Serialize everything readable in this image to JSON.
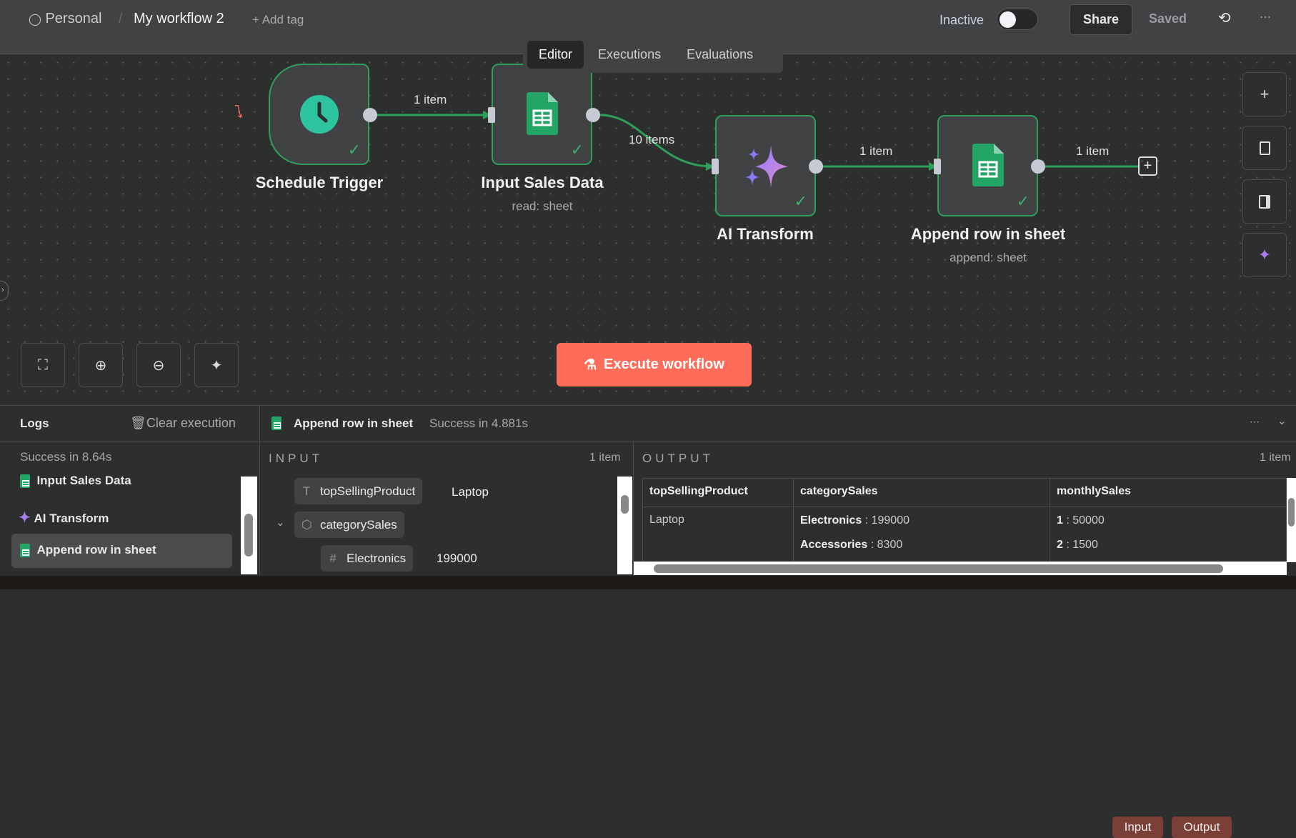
{
  "header": {
    "project": "Personal",
    "workflow_name": "My workflow 2",
    "add_tag": "+ Add tag",
    "status": "Inactive",
    "active": false,
    "share": "Share",
    "saved": "Saved"
  },
  "tabs": [
    {
      "label": "Editor",
      "active": true
    },
    {
      "label": "Executions"
    },
    {
      "label": "Evaluations"
    }
  ],
  "nodes": [
    {
      "name": "Schedule Trigger"
    },
    {
      "name": "Input Sales Data",
      "subtitle": "read: sheet"
    },
    {
      "name": "AI Transform"
    },
    {
      "name": "Append row in sheet",
      "subtitle": "append: sheet"
    }
  ],
  "edges": [
    "1 item",
    "10 items",
    "1 item",
    "1 item"
  ],
  "execute_button": "Execute workflow",
  "colors": {
    "accent": "#ff6d5a",
    "success": "#2f9e5a",
    "topbar": "#414244",
    "canvas": "#2d2e2e"
  },
  "logs": {
    "title": "Logs",
    "clear": "Clear execution",
    "summary": "Success in 8.64s",
    "items": [
      {
        "label": "Input Sales Data"
      },
      {
        "label": "AI Transform"
      },
      {
        "label": "Append row in sheet",
        "selected": true
      }
    ]
  },
  "detail": {
    "node": "Append row in sheet",
    "status": "Success in 4.881s",
    "input_btn": "Input",
    "output_btn": "Output",
    "input": {
      "title": "INPUT",
      "count": "1 item",
      "fields": [
        {
          "key": "topSellingProduct",
          "type": "T",
          "value": "Laptop"
        },
        {
          "key": "categorySales",
          "type": "object"
        },
        {
          "key": "Electronics",
          "type": "#",
          "value": "199000"
        }
      ]
    },
    "output": {
      "title": "OUTPUT",
      "count": "1 item",
      "columns": [
        "topSellingProduct",
        "categorySales",
        "monthlySales"
      ],
      "row": {
        "topSellingProduct": "Laptop",
        "categorySales": [
          {
            "k": "Electronics",
            "v": "199000"
          },
          {
            "k": "Accessories",
            "v": "8300"
          }
        ],
        "monthlySales": [
          {
            "k": "1",
            "v": "50000"
          },
          {
            "k": "2",
            "v": "1500"
          }
        ]
      }
    }
  }
}
